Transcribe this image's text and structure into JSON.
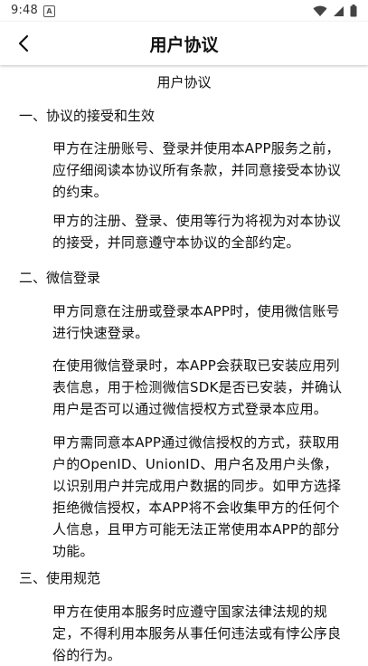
{
  "status_bar": {
    "time": "9:48",
    "notification_icon": "a-icon"
  },
  "app_bar": {
    "title": "用户协议",
    "back_icon": "chevron-left-icon"
  },
  "document": {
    "title": "用户协议",
    "sections": [
      {
        "heading": "一、协议的接受和生效",
        "paragraphs": [
          "甲方在注册账号、登录并使用本APP服务之前，应仔细阅读本协议所有条款，并同意接受本协议的约束。",
          "甲方的注册、登录、使用等行为将视为对本协议的接受，并同意遵守本协议的全部约定。"
        ]
      },
      {
        "heading": "二、微信登录",
        "paragraphs": [
          "甲方同意在注册或登录本APP时，使用微信账号进行快速登录。",
          "在使用微信登录时，本APP会获取已安装应用列表信息，用于检测微信SDK是否已安装，并确认用户是否可以通过微信授权方式登录本应用。",
          "甲方需同意本APP通过微信授权的方式，获取用户的OpenID、UnionID、用户名及用户头像，以识别用户并完成用户数据的同步。如甲方选择拒绝微信授权，本APP将不会收集甲方的任何个人信息，且甲方可能无法正常使用本APP的部分功能。"
        ]
      },
      {
        "heading": "三、使用规范",
        "paragraphs": [
          "甲方在使用本服务时应遵守国家法律法规的规定，不得利用本服务从事任何违法或有悖公序良俗的行为。"
        ]
      }
    ]
  }
}
